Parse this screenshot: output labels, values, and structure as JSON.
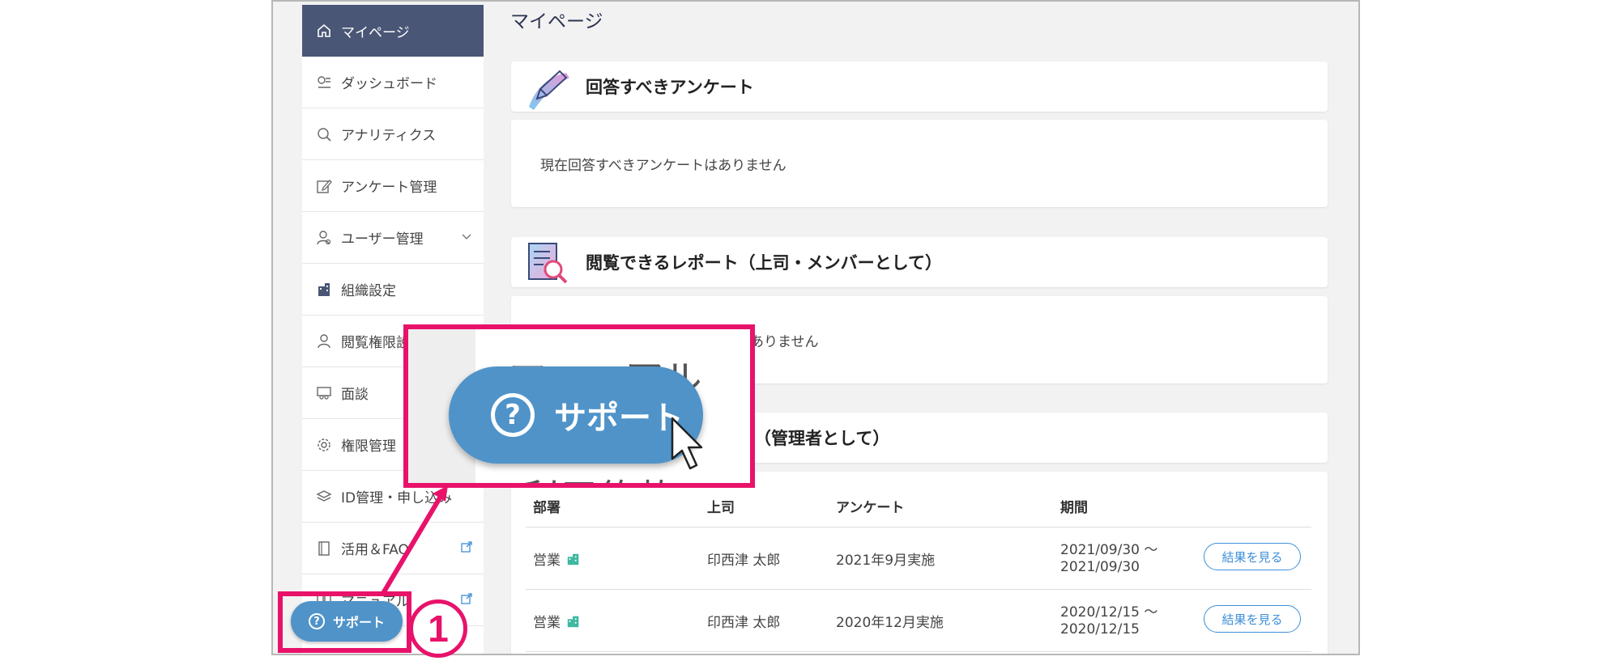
{
  "sidebar": {
    "items": [
      {
        "label": "マイページ",
        "icon": "home-icon"
      },
      {
        "label": "ダッシュボード",
        "icon": "dashboard-icon"
      },
      {
        "label": "アナリティクス",
        "icon": "search-icon"
      },
      {
        "label": "アンケート管理",
        "icon": "edit-icon"
      },
      {
        "label": "ユーザー管理",
        "icon": "users-icon"
      },
      {
        "label": "組織設定",
        "icon": "building-icon"
      },
      {
        "label": "閲覧権限設",
        "icon": "person-icon"
      },
      {
        "label": "面談",
        "icon": "meeting-icon"
      },
      {
        "label": "権限管理",
        "icon": "gear-icon"
      },
      {
        "label": "ID管理・申し込み",
        "icon": "layers-icon"
      },
      {
        "label": "活用＆FAQ",
        "icon": "book-icon"
      },
      {
        "label": "マニュアル",
        "icon": "manual-icon"
      }
    ]
  },
  "main": {
    "page_title": "マイページ",
    "answer_card": {
      "title": "回答すべきアンケート",
      "empty_text": "現在回答すべきアンケートはありません"
    },
    "report_card": {
      "title": "閲覧できるレポート（上司・メンバーとして）",
      "empty_text": "ありません"
    },
    "admin_card": {
      "title": "（管理者として）"
    },
    "table": {
      "headers": [
        "部署",
        "上司",
        "アンケート",
        "期間"
      ],
      "rows": [
        {
          "dept": "営業",
          "boss": "印西津 太郎",
          "survey": "2021年9月実施",
          "period_start": "2021/09/30 ～",
          "period_end": "2021/09/30",
          "action": "結果を見る"
        },
        {
          "dept": "営業",
          "boss": "印西津 太郎",
          "survey": "2020年12月実施",
          "period_start": "2020/12/15 ～",
          "period_end": "2020/12/15",
          "action": "結果を見る"
        }
      ]
    }
  },
  "support_button": {
    "label": "サポート",
    "icon": "question-circle-icon"
  },
  "step_number": "1",
  "zoom": {
    "top_text": "マニュアル",
    "button_label": "サポート",
    "bottom_text": "利用約款"
  },
  "colors": {
    "accent": "#e8126a",
    "support": "#4f93c9",
    "sidebar_active": "#4a5676",
    "link": "#3d8fd8"
  }
}
